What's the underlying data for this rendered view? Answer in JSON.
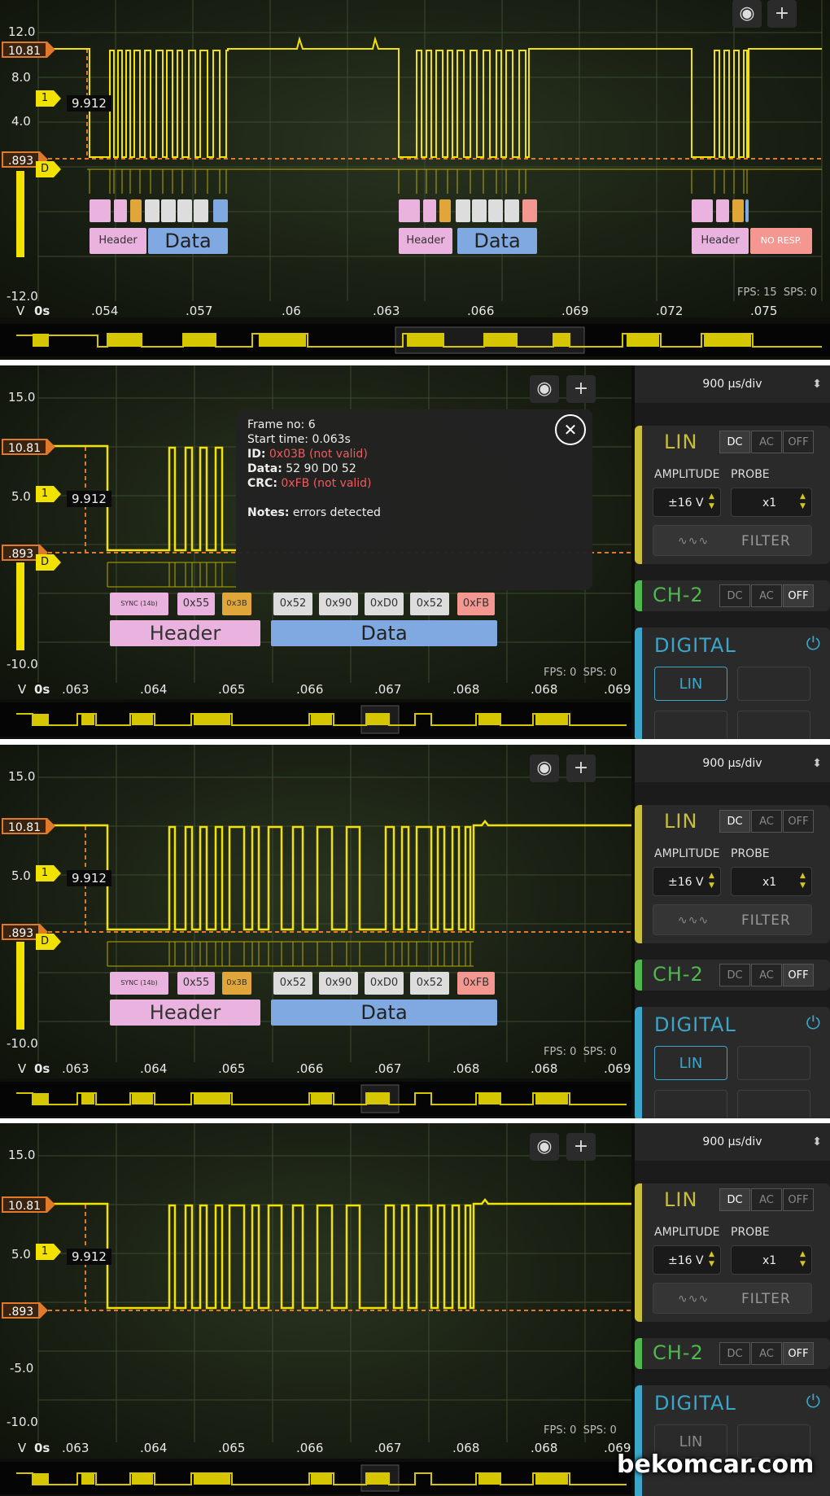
{
  "watermark": "bekomcar.com",
  "panel1": {
    "y_ticks": [
      "12.0",
      "8.0",
      "4.0",
      "-12.0"
    ],
    "marker_top": "10.81",
    "marker_bottom": ".893",
    "trigger_channel": "1",
    "trigger_value": "9.912",
    "trigger2": "D",
    "x_unit": "V",
    "x_ticks": [
      "0s",
      ".054",
      ".057",
      ".06",
      ".063",
      ".066",
      ".069",
      ".072",
      ".075"
    ],
    "status": "FPS: 15  SPS: 0",
    "frames": [
      {
        "header": "Header",
        "data": "Data"
      },
      {
        "header": "Header",
        "data": "Data"
      },
      {
        "header": "Header",
        "data": "NO RESP."
      }
    ]
  },
  "zoom_panel": {
    "timebase": "900 µs/div",
    "lin": {
      "title": "LIN",
      "coupling": [
        "DC",
        "AC",
        "OFF"
      ],
      "amplitude_label": "AMPLITUDE",
      "probe_label": "PROBE",
      "amplitude": "±16 V",
      "probe": "x1",
      "filter": "FILTER"
    },
    "ch2": {
      "title": "CH-2",
      "coupling": [
        "DC",
        "AC",
        "OFF"
      ]
    },
    "digital": {
      "title": "DIGITAL",
      "button": "LIN"
    },
    "y_ticks": [
      "15.0",
      "5.0",
      "-10.0"
    ],
    "panel4_extra_tick": "-5.0",
    "marker_top": "10.81",
    "marker_bottom": ".893",
    "trigger_channel": "1",
    "trigger_value": "9.912",
    "trigger2": "D",
    "x_unit": "V",
    "x_ticks": [
      "0s",
      ".063",
      ".064",
      ".065",
      ".066",
      ".067",
      ".068",
      ".068",
      ".069"
    ],
    "status": "FPS: 0  SPS: 0",
    "decode": {
      "sync": "SYNC (14b)",
      "pid": "0x55",
      "id": "0x3B",
      "bytes": [
        "0x52",
        "0x90",
        "0xD0",
        "0x52"
      ],
      "crc": "0xFB",
      "header": "Header",
      "data": "Data"
    }
  },
  "popup": {
    "frame_label": "Frame no:",
    "frame_value": "6",
    "start_label": "Start time:",
    "start_value": "0.063s",
    "id_label": "ID:",
    "id_value": "0x03B (not valid)",
    "data_label": "Data:",
    "data_value": "52 90 D0 52",
    "crc_label": "CRC:",
    "crc_value": "0xFB (not valid)",
    "notes_label": "Notes:",
    "notes_value": "errors detected"
  },
  "colors": {
    "trace": "#f2e200",
    "marker": "#e07a2a",
    "header": "#eab3df",
    "data": "#7fa9e0",
    "lin": "#c9be3a",
    "ch2": "#4fb84f",
    "digital": "#3ba6c9"
  }
}
